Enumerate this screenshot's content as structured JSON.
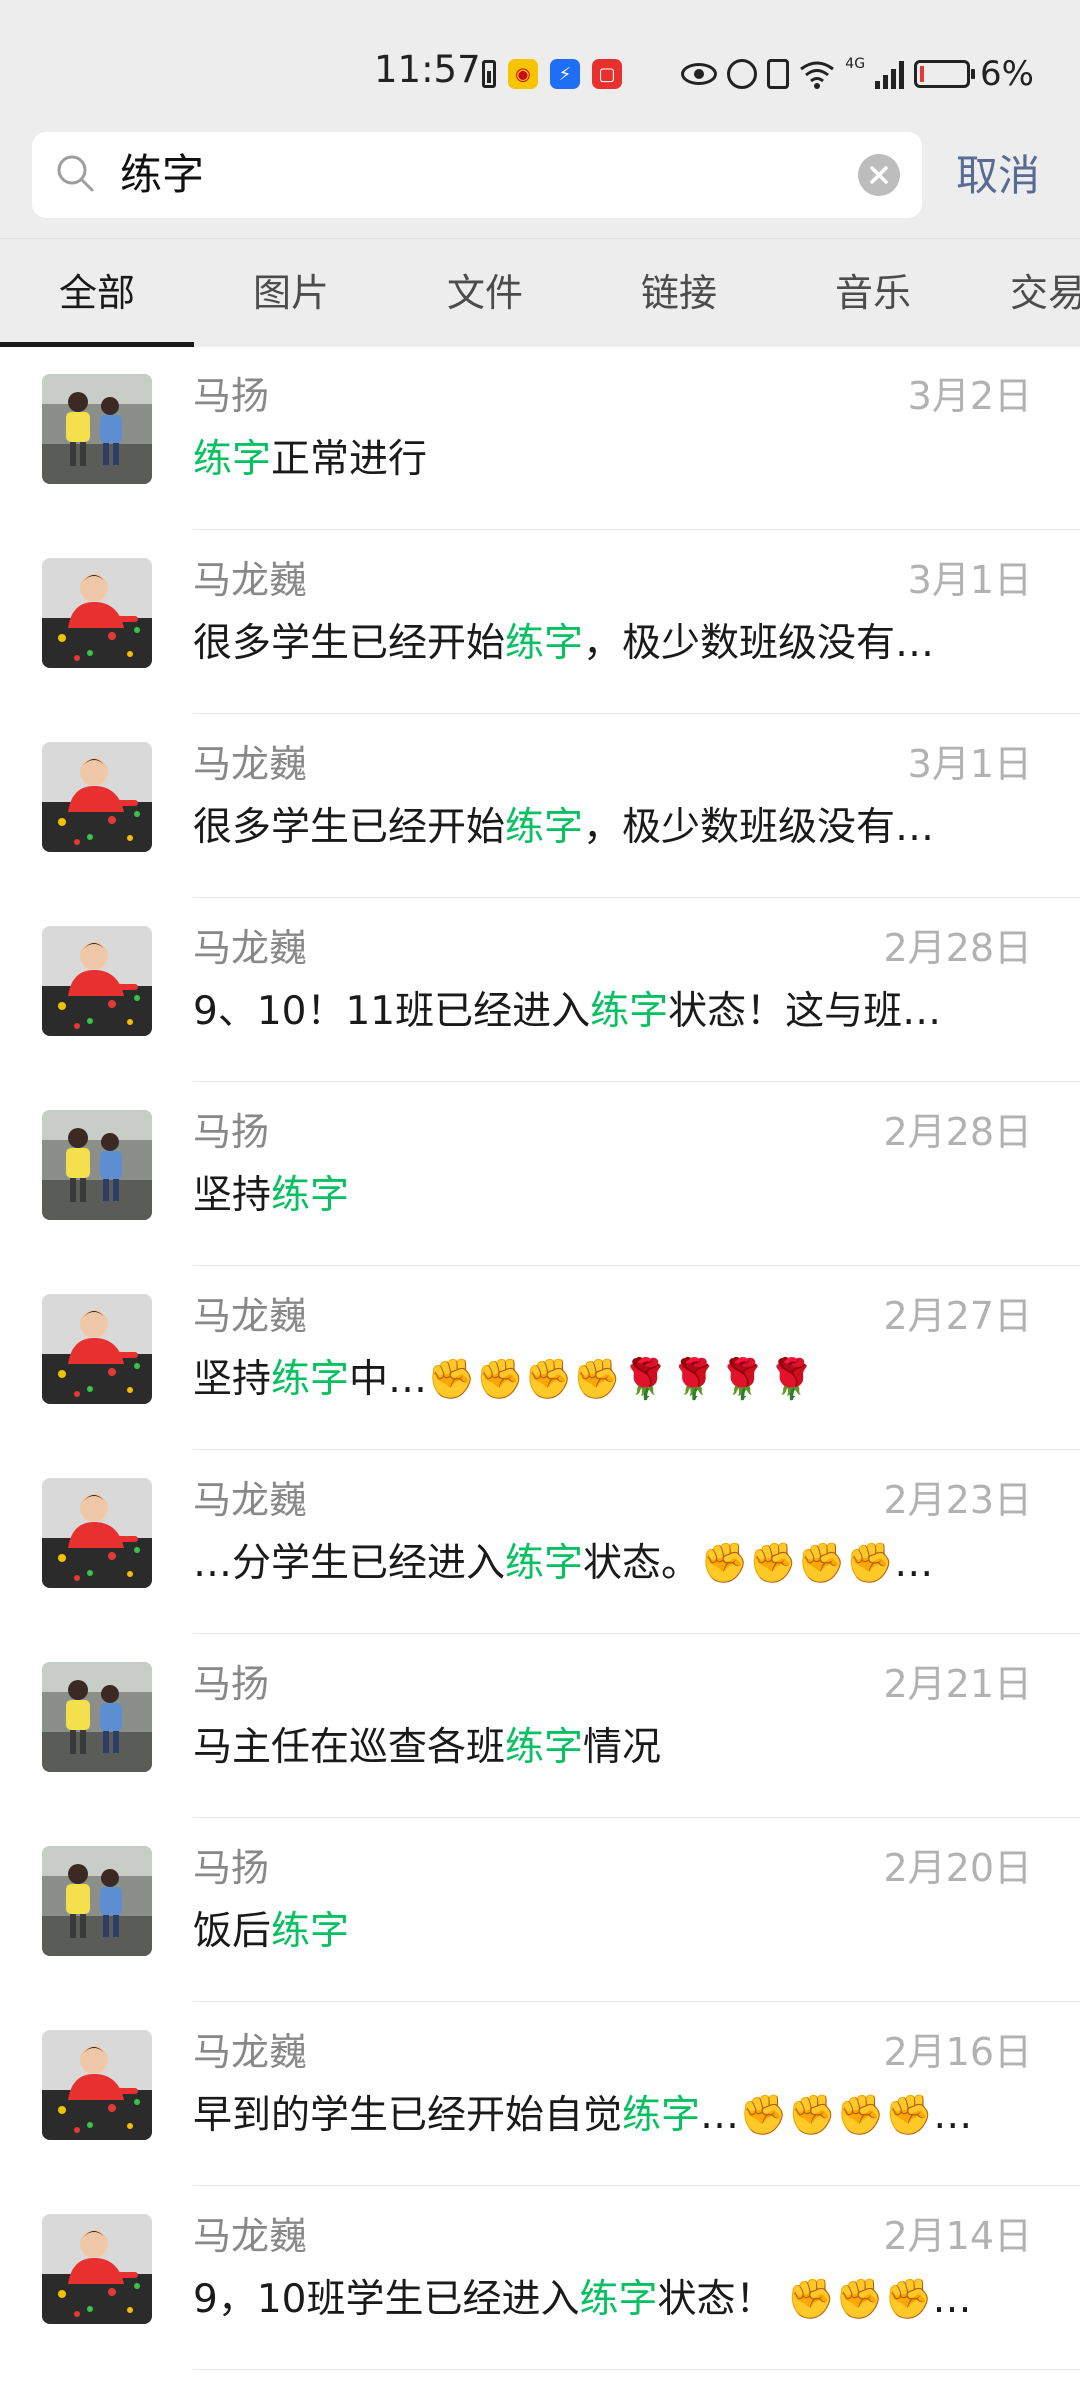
{
  "status_bar": {
    "time": "11:57",
    "network": "4G",
    "battery_percent": "6%",
    "battery_level": 0.06,
    "icons": [
      "battery-small-icon",
      "weibo-icon",
      "blue-app-icon",
      "red-app-icon",
      "eye-icon",
      "alarm-icon",
      "vibrate-icon",
      "wifi-icon",
      "signal-icon",
      "battery-icon"
    ]
  },
  "search": {
    "query": "练字",
    "cancel_label": "取消"
  },
  "tabs": [
    {
      "label": "全部",
      "active": true
    },
    {
      "label": "图片"
    },
    {
      "label": "文件"
    },
    {
      "label": "链接"
    },
    {
      "label": "音乐"
    },
    {
      "label": "交易"
    }
  ],
  "results": [
    {
      "sender": "马扬",
      "date": "3月2日",
      "avatar": "kids",
      "parts": [
        {
          "t": "练字",
          "h": true
        },
        {
          "t": "正常进行",
          "h": false
        }
      ]
    },
    {
      "sender": "马龙巍",
      "date": "3月1日",
      "avatar": "child",
      "parts": [
        {
          "t": "很多学生已经开始",
          "h": false
        },
        {
          "t": "练字",
          "h": true
        },
        {
          "t": "，极少数班级没有…",
          "h": false
        }
      ]
    },
    {
      "sender": "马龙巍",
      "date": "3月1日",
      "avatar": "child",
      "parts": [
        {
          "t": "很多学生已经开始",
          "h": false
        },
        {
          "t": "练字",
          "h": true
        },
        {
          "t": "，极少数班级没有…",
          "h": false
        }
      ]
    },
    {
      "sender": "马龙巍",
      "date": "2月28日",
      "avatar": "child",
      "parts": [
        {
          "t": "9、10！11班已经进入",
          "h": false
        },
        {
          "t": "练字",
          "h": true
        },
        {
          "t": "状态！这与班…",
          "h": false
        }
      ]
    },
    {
      "sender": "马扬",
      "date": "2月28日",
      "avatar": "kids",
      "parts": [
        {
          "t": "坚持",
          "h": false
        },
        {
          "t": "练字",
          "h": true
        }
      ]
    },
    {
      "sender": "马龙巍",
      "date": "2月27日",
      "avatar": "child",
      "parts": [
        {
          "t": "坚持",
          "h": false
        },
        {
          "t": "练字",
          "h": true
        },
        {
          "t": "中…✊✊✊✊🌹🌹🌹🌹",
          "h": false
        }
      ]
    },
    {
      "sender": "马龙巍",
      "date": "2月23日",
      "avatar": "child",
      "parts": [
        {
          "t": "…分学生已经进入",
          "h": false
        },
        {
          "t": "练字",
          "h": true
        },
        {
          "t": "状态。✊✊✊✊…",
          "h": false
        }
      ]
    },
    {
      "sender": "马扬",
      "date": "2月21日",
      "avatar": "kids",
      "parts": [
        {
          "t": "马主任在巡查各班",
          "h": false
        },
        {
          "t": "练字",
          "h": true
        },
        {
          "t": "情况",
          "h": false
        }
      ]
    },
    {
      "sender": "马扬",
      "date": "2月20日",
      "avatar": "kids",
      "parts": [
        {
          "t": "饭后",
          "h": false
        },
        {
          "t": "练字",
          "h": true
        }
      ]
    },
    {
      "sender": "马龙巍",
      "date": "2月16日",
      "avatar": "child",
      "parts": [
        {
          "t": "早到的学生已经开始自觉",
          "h": false
        },
        {
          "t": "练字",
          "h": true
        },
        {
          "t": "…✊✊✊✊…",
          "h": false
        }
      ]
    },
    {
      "sender": "马龙巍",
      "date": "2月14日",
      "avatar": "child",
      "parts": [
        {
          "t": "9，10班学生已经进入",
          "h": false
        },
        {
          "t": "练字",
          "h": true
        },
        {
          "t": "状态！ ✊✊✊…",
          "h": false
        }
      ]
    }
  ],
  "colors": {
    "highlight": "#07c160",
    "cancel": "#576b95",
    "background_top": "#ededed"
  }
}
